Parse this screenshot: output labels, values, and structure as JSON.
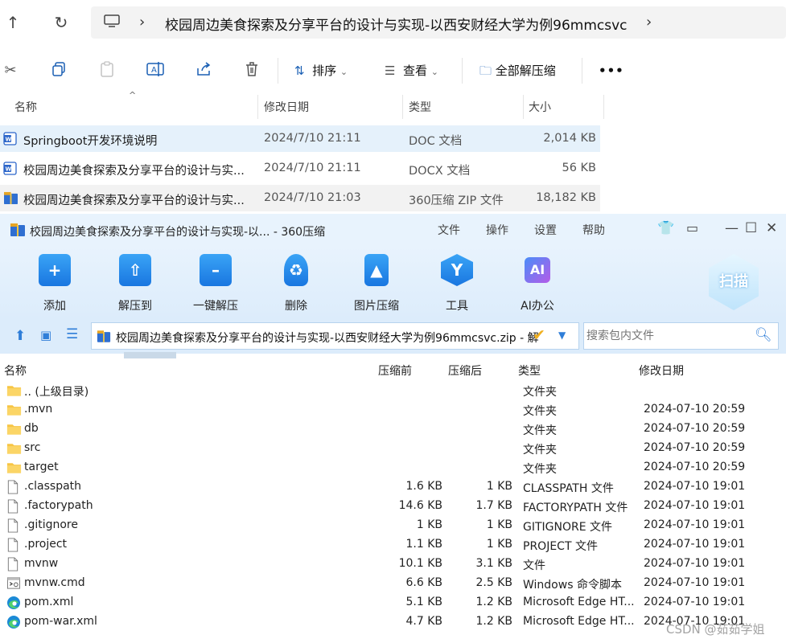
{
  "explorer": {
    "breadcrumb": "校园周边美食探索及分享平台的设计与实现-以西安财经大学为例96mmcsvc",
    "cmdbar": {
      "sort": "排序",
      "view": "查看",
      "extract_all": "全部解压缩",
      "more": "•••"
    },
    "columns": {
      "name": "名称",
      "modified": "修改日期",
      "type": "类型",
      "size": "大小"
    },
    "files": [
      {
        "name": "Springboot开发环境说明",
        "date": "2024/7/10 21:11",
        "type": "DOC 文档",
        "size": "2,014 KB",
        "icon": "word-doc-icon"
      },
      {
        "name": "校园周边美食探索及分享平台的设计与实...",
        "date": "2024/7/10 21:11",
        "type": "DOCX 文档",
        "size": "56 KB",
        "icon": "word-doc-icon"
      },
      {
        "name": "校园周边美食探索及分享平台的设计与实...",
        "date": "2024/7/10 21:03",
        "type": "360压缩 ZIP 文件",
        "size": "18,182 KB",
        "icon": "zip-archive-icon"
      }
    ]
  },
  "zip": {
    "title": "校园周边美食探索及分享平台的设计与实现-以... - 360压缩",
    "menu": [
      "文件",
      "操作",
      "设置",
      "帮助"
    ],
    "toolbar": [
      "添加",
      "解压到",
      "一键解压",
      "删除",
      "图片压缩",
      "工具",
      "AI办公"
    ],
    "ai_badge": "AI",
    "scan": "扫描",
    "path": "校园周边美食探索及分享平台的设计与实现-以西安财经大学为例96mmcsvc.zip - 解",
    "search_placeholder": "搜索包内文件",
    "columns": {
      "name": "名称",
      "before": "压缩前",
      "after": "压缩后",
      "type": "类型",
      "date": "修改日期"
    },
    "rows": [
      {
        "name": ".. (上级目录)",
        "before": "",
        "after": "",
        "type": "文件夹",
        "date": "",
        "icon": "folder-icon"
      },
      {
        "name": ".mvn",
        "before": "",
        "after": "",
        "type": "文件夹",
        "date": "2024-07-10 20:59",
        "icon": "folder-icon"
      },
      {
        "name": "db",
        "before": "",
        "after": "",
        "type": "文件夹",
        "date": "2024-07-10 20:59",
        "icon": "folder-icon"
      },
      {
        "name": "src",
        "before": "",
        "after": "",
        "type": "文件夹",
        "date": "2024-07-10 20:59",
        "icon": "folder-icon"
      },
      {
        "name": "target",
        "before": "",
        "after": "",
        "type": "文件夹",
        "date": "2024-07-10 20:59",
        "icon": "folder-icon"
      },
      {
        "name": ".classpath",
        "before": "1.6 KB",
        "after": "1 KB",
        "type": "CLASSPATH 文件",
        "date": "2024-07-10 19:01",
        "icon": "file-icon"
      },
      {
        "name": ".factorypath",
        "before": "14.6 KB",
        "after": "1.7 KB",
        "type": "FACTORYPATH 文件",
        "date": "2024-07-10 19:01",
        "icon": "file-icon"
      },
      {
        "name": ".gitignore",
        "before": "1 KB",
        "after": "1 KB",
        "type": "GITIGNORE 文件",
        "date": "2024-07-10 19:01",
        "icon": "file-icon"
      },
      {
        "name": ".project",
        "before": "1.1 KB",
        "after": "1 KB",
        "type": "PROJECT 文件",
        "date": "2024-07-10 19:01",
        "icon": "file-icon"
      },
      {
        "name": "mvnw",
        "before": "10.1 KB",
        "after": "3.1 KB",
        "type": "文件",
        "date": "2024-07-10 19:01",
        "icon": "file-icon"
      },
      {
        "name": "mvnw.cmd",
        "before": "6.6 KB",
        "after": "2.5 KB",
        "type": "Windows 命令脚本",
        "date": "2024-07-10 19:01",
        "icon": "cmd-script-icon"
      },
      {
        "name": "pom.xml",
        "before": "5.1 KB",
        "after": "1.2 KB",
        "type": "Microsoft Edge HT...",
        "date": "2024-07-10 19:01",
        "icon": "edge-icon"
      },
      {
        "name": "pom-war.xml",
        "before": "4.7 KB",
        "after": "1.2 KB",
        "type": "Microsoft Edge HT...",
        "date": "2024-07-10 19:01",
        "icon": "edge-icon"
      }
    ]
  },
  "watermark": "CSDN @茹茹学姐",
  "colors": {
    "accent": "#1976e0",
    "selected": "#e5f1fb",
    "titlebar": "#e8f3fd"
  }
}
